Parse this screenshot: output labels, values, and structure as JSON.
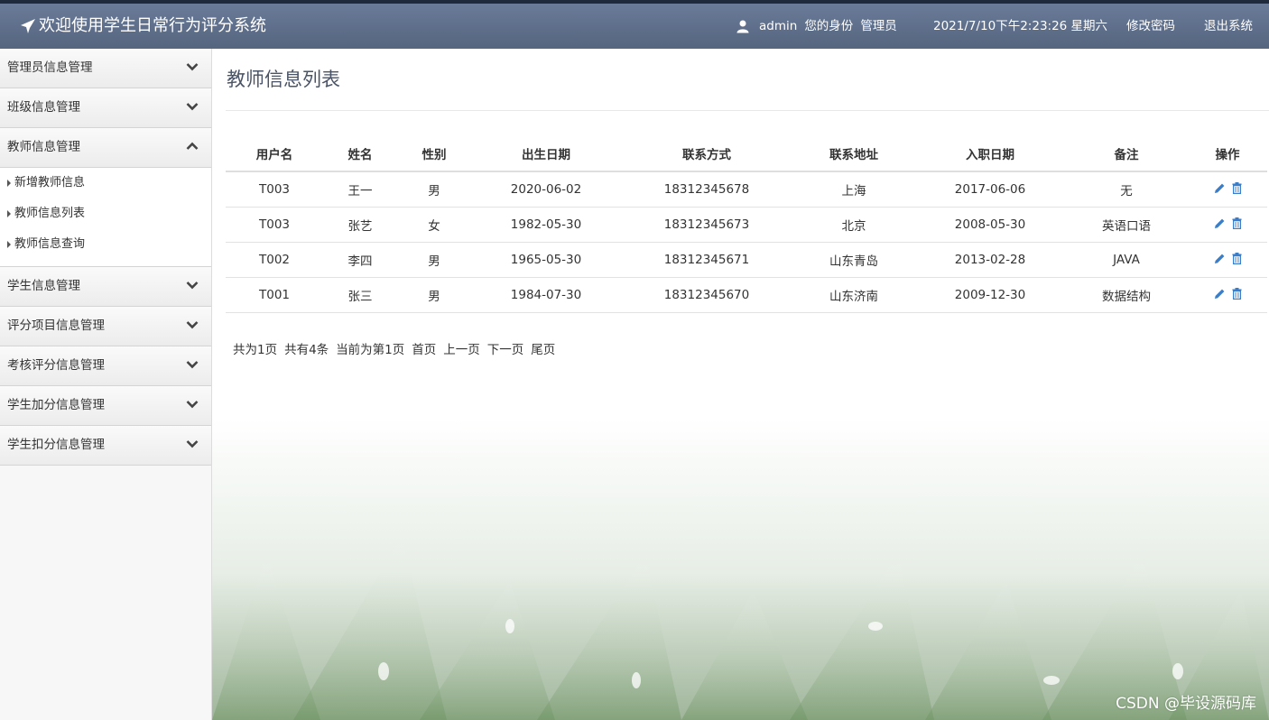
{
  "header": {
    "title": "欢迎使用学生日常行为评分系统",
    "username": "admin",
    "identity_label": "您的身份",
    "identity": "管理员",
    "datetime": "2021/7/10下午2:23:26 星期六",
    "change_password": "修改密码",
    "logout": "退出系统"
  },
  "sidebar": {
    "sections": [
      {
        "label": "管理员信息管理",
        "expanded": false
      },
      {
        "label": "班级信息管理",
        "expanded": false
      },
      {
        "label": "教师信息管理",
        "expanded": true,
        "items": [
          "新增教师信息",
          "教师信息列表",
          "教师信息查询"
        ]
      },
      {
        "label": "学生信息管理",
        "expanded": false
      },
      {
        "label": "评分项目信息管理",
        "expanded": false
      },
      {
        "label": "考核评分信息管理",
        "expanded": false
      },
      {
        "label": "学生加分信息管理",
        "expanded": false
      },
      {
        "label": "学生扣分信息管理",
        "expanded": false
      }
    ]
  },
  "main": {
    "title": "教师信息列表",
    "columns": [
      "用户名",
      "姓名",
      "性别",
      "出生日期",
      "联系方式",
      "联系地址",
      "入职日期",
      "备注",
      "操作"
    ],
    "rows": [
      [
        "T003",
        "王一",
        "男",
        "2020-06-02",
        "18312345678",
        "上海",
        "2017-06-06",
        "无"
      ],
      [
        "T003",
        "张艺",
        "女",
        "1982-05-30",
        "18312345673",
        "北京",
        "2008-05-30",
        "英语口语"
      ],
      [
        "T002",
        "李四",
        "男",
        "1965-05-30",
        "18312345671",
        "山东青岛",
        "2013-02-28",
        "JAVA"
      ],
      [
        "T001",
        "张三",
        "男",
        "1984-07-30",
        "18312345670",
        "山东济南",
        "2009-12-30",
        "数据结构"
      ]
    ],
    "pager": {
      "total_pages": "共为1页",
      "total_items": "共有4条",
      "current": "当前为第1页",
      "first": "首页",
      "prev": "上一页",
      "next": "下一页",
      "last": "尾页"
    }
  },
  "watermark": "CSDN @毕设源码库",
  "icons": {
    "edit": "pencil-icon",
    "delete": "trash-icon"
  },
  "colors": {
    "header": "#5f7090",
    "icon_blue": "#3a7dc9",
    "title": "#4a5466"
  }
}
